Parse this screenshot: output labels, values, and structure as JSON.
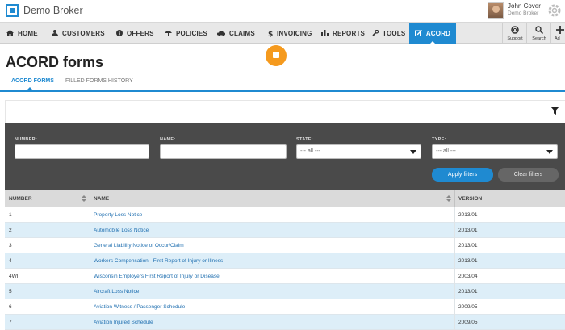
{
  "header": {
    "brand": "Demo Broker",
    "user_name": "John Cover",
    "user_org": "Demo Broker"
  },
  "nav": {
    "items": [
      {
        "label": "HOME",
        "icon": "home-icon"
      },
      {
        "label": "CUSTOMERS",
        "icon": "user-icon"
      },
      {
        "label": "OFFERS",
        "icon": "info-icon"
      },
      {
        "label": "POLICIES",
        "icon": "umbrella-icon"
      },
      {
        "label": "CLAIMS",
        "icon": "car-icon"
      },
      {
        "label": "INVOICING",
        "icon": "dollar-icon"
      },
      {
        "label": "REPORTS",
        "icon": "bar-chart-icon"
      },
      {
        "label": "TOOLS",
        "icon": "wrench-icon"
      },
      {
        "label": "ACORD",
        "icon": "edit-icon"
      }
    ],
    "active": "ACORD",
    "tools": [
      {
        "label": "Support",
        "icon": "lifebuoy-icon"
      },
      {
        "label": "Search",
        "icon": "search-icon"
      },
      {
        "label": "Ad",
        "icon": "plus-icon"
      }
    ]
  },
  "page": {
    "title": "ACORD forms",
    "tabs": [
      "ACORD FORMS",
      "FILLED FORMS HISTORY"
    ],
    "active_tab": "ACORD FORMS"
  },
  "filters": {
    "number_label": "NUMBER:",
    "number_value": "",
    "name_label": "NAME:",
    "name_value": "",
    "state_label": "STATE:",
    "state_value": "--- all ---",
    "type_label": "TYPE:",
    "type_value": "--- all ---",
    "apply_label": "Apply filters",
    "clear_label": "Clear filters"
  },
  "table": {
    "columns": [
      "NUMBER",
      "NAME",
      "VERSION"
    ],
    "rows": [
      {
        "number": "1",
        "name": "Property Loss Notice",
        "version": "2013/01"
      },
      {
        "number": "2",
        "name": "Automobile Loss Notice",
        "version": "2013/01"
      },
      {
        "number": "3",
        "name": "General Liability Notice of Occur/Claim",
        "version": "2013/01"
      },
      {
        "number": "4",
        "name": "Workers Compensation - First Report of Injury or Illness",
        "version": "2013/01"
      },
      {
        "number": "4WI",
        "name": "Wisconsin Employers First Report of Injury or Disease",
        "version": "2003/04"
      },
      {
        "number": "5",
        "name": "Aircraft Loss Notice",
        "version": "2013/01"
      },
      {
        "number": "6",
        "name": "Aviation Witness / Passenger Schedule",
        "version": "2009/05"
      },
      {
        "number": "7",
        "name": "Aviation Injured Schedule",
        "version": "2009/05"
      }
    ]
  },
  "colors": {
    "accent": "#1f8ad1",
    "help": "#f59a1e",
    "panel": "#4a4a4a"
  }
}
